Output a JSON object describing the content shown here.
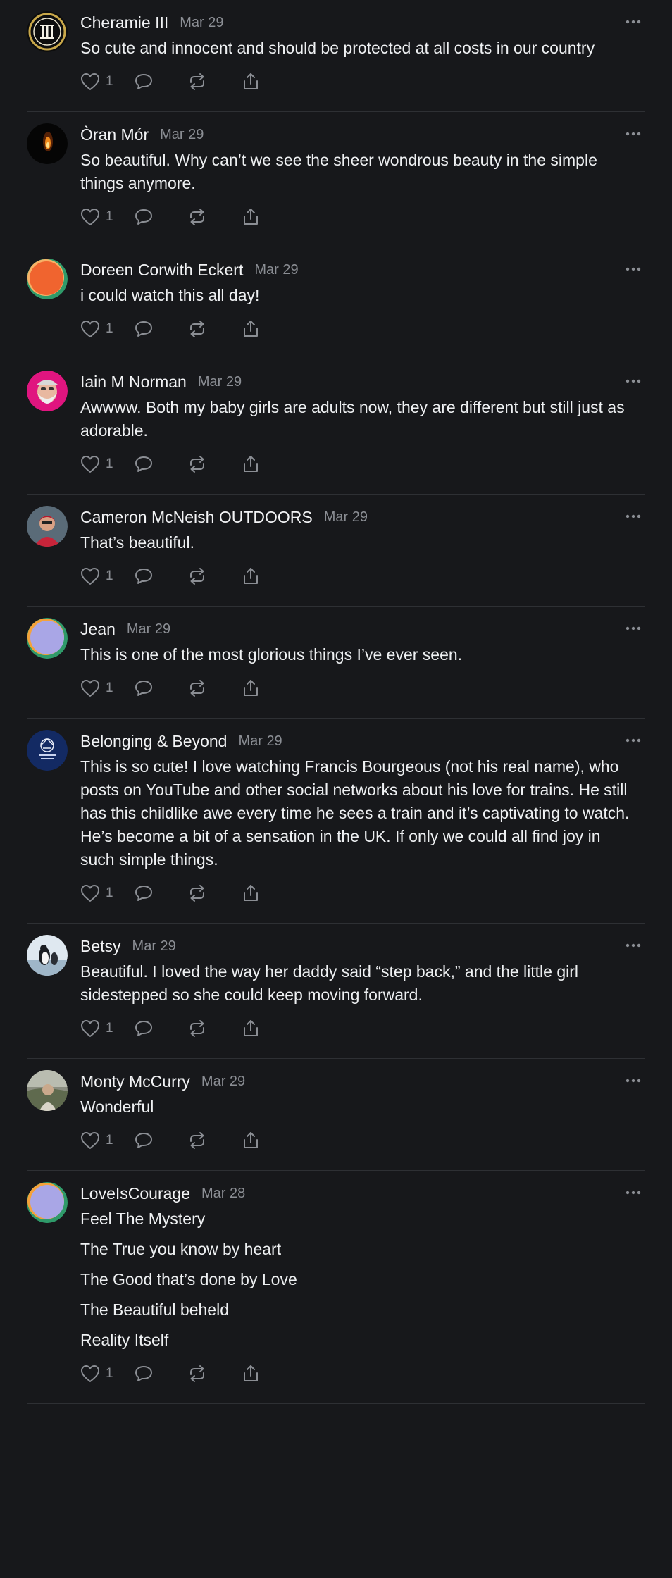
{
  "comments": [
    {
      "author": "Cheramie III",
      "date": "Mar 29",
      "avatar": "triple-i-seal-avatar",
      "likes": "1",
      "lines": [
        "So cute and innocent and should be protected at all costs in our country"
      ]
    },
    {
      "author": "Òran Mór",
      "date": "Mar 29",
      "avatar": "candle-flame-avatar",
      "likes": "1",
      "lines": [
        "So beautiful. Why can’t we see the sheer wondrous beauty in the simple things anymore."
      ]
    },
    {
      "author": "Doreen Corwith Eckert",
      "date": "Mar 29",
      "avatar": "orange-default-avatar",
      "likes": "1",
      "lines": [
        "i could watch this all day!"
      ]
    },
    {
      "author": "Iain M Norman",
      "date": "Mar 29",
      "avatar": "bearded-man-avatar",
      "likes": "1",
      "lines": [
        "Awwww. Both my baby girls are adults now, they are different but still just as adorable."
      ]
    },
    {
      "author": "Cameron McNeish OUTDOORS",
      "date": "Mar 29",
      "avatar": "hiker-avatar",
      "likes": "1",
      "lines": [
        "That’s beautiful."
      ]
    },
    {
      "author": "Jean",
      "date": "Mar 29",
      "avatar": "lavender-default-avatar",
      "likes": "1",
      "lines": [
        "This is one of the most glorious things I’ve ever seen."
      ]
    },
    {
      "author": "Belonging & Beyond",
      "date": "Mar 29",
      "avatar": "navy-emblem-avatar",
      "likes": "1",
      "lines": [
        "This is so cute! I love watching Francis Bourgeous (not his real name), who posts on YouTube and other social networks about his love for trains. He still has this childlike awe every time he sees a train and it’s captivating to watch. He’s become a bit of a sensation in the UK. If only we could all find joy in such simple things."
      ]
    },
    {
      "author": "Betsy",
      "date": "Mar 29",
      "avatar": "penguin-photo-avatar",
      "likes": "1",
      "lines": [
        "Beautiful. I loved the way her daddy said “step back,” and the little girl sidestepped so she could keep moving forward."
      ]
    },
    {
      "author": "Monty McCurry",
      "date": "Mar 29",
      "avatar": "outdoor-portrait-avatar",
      "likes": "1",
      "lines": [
        "Wonderful"
      ]
    },
    {
      "author": "LoveIsCourage",
      "date": "Mar 28",
      "avatar": "lavender-default-avatar",
      "likes": "1",
      "lines": [
        "Feel The Mystery",
        "The True you know by heart",
        "The Good that’s done by Love",
        "The Beautiful beheld",
        "Reality Itself"
      ]
    }
  ],
  "colors": {
    "background": "#17181b",
    "text": "#eef0f2",
    "muted": "#8b8e94",
    "divider": "#2e3034"
  }
}
